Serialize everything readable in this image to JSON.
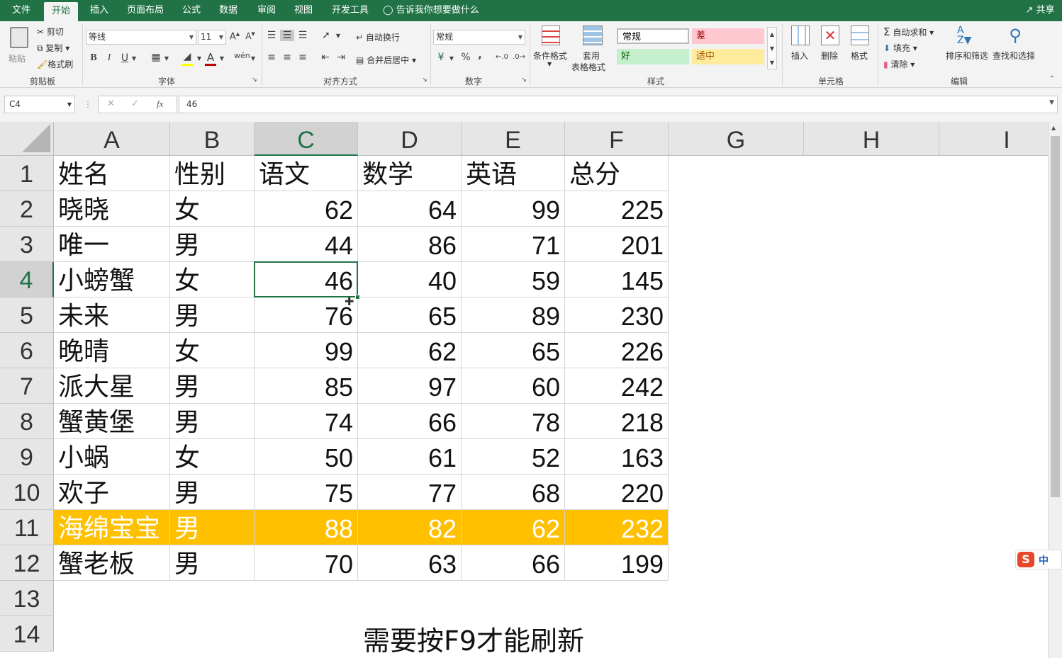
{
  "menu": {
    "tabs": [
      "文件",
      "开始",
      "插入",
      "页面布局",
      "公式",
      "数据",
      "审阅",
      "视图",
      "开发工具"
    ],
    "active": "开始",
    "tell_me": "告诉我你想要做什么",
    "share": "共享"
  },
  "ribbon": {
    "clipboard": {
      "paste": "粘贴",
      "cut": "剪切",
      "copy": "复制",
      "format_painter": "格式刷",
      "label": "剪贴板"
    },
    "font": {
      "name": "等线",
      "size": "11",
      "bold": "B",
      "italic": "I",
      "underline": "U",
      "label": "字体"
    },
    "alignment": {
      "wrap": "自动换行",
      "merge": "合并后居中",
      "label": "对齐方式"
    },
    "number": {
      "format": "常规",
      "percent": "%",
      "comma": ",",
      "label": "数字"
    },
    "styles": {
      "conditional": "条件格式",
      "table_line1": "套用",
      "table_line2": "表格格式",
      "normal": "常规",
      "bad": "差",
      "good": "好",
      "neutral": "适中",
      "label": "样式"
    },
    "cells": {
      "insert": "插入",
      "delete": "删除",
      "format": "格式",
      "label": "单元格"
    },
    "editing": {
      "autosum": "自动求和",
      "fill": "填充",
      "clear": "清除",
      "sort": "排序和筛选",
      "find": "查找和选择",
      "label": "编辑"
    }
  },
  "formula_bar": {
    "name_box": "C4",
    "fx": "fx",
    "value": "46"
  },
  "sheet": {
    "columns": [
      "A",
      "B",
      "C",
      "D",
      "E",
      "F",
      "G",
      "H",
      "I"
    ],
    "rows": [
      "1",
      "2",
      "3",
      "4",
      "5",
      "6",
      "7",
      "8",
      "9",
      "10",
      "11",
      "12",
      "13",
      "14"
    ],
    "header": [
      "姓名",
      "性别",
      "语文",
      "数学",
      "英语",
      "总分"
    ],
    "data": [
      [
        "晓晓",
        "女",
        "62",
        "64",
        "99",
        "225"
      ],
      [
        "唯一",
        "男",
        "44",
        "86",
        "71",
        "201"
      ],
      [
        "小螃蟹",
        "女",
        "46",
        "40",
        "59",
        "145"
      ],
      [
        "未来",
        "男",
        "76",
        "65",
        "89",
        "230"
      ],
      [
        "晚晴",
        "女",
        "99",
        "62",
        "65",
        "226"
      ],
      [
        "派大星",
        "男",
        "85",
        "97",
        "60",
        "242"
      ],
      [
        "蟹黄堡",
        "男",
        "74",
        "66",
        "78",
        "218"
      ],
      [
        "小蜗",
        "女",
        "50",
        "61",
        "52",
        "163"
      ],
      [
        "欢子",
        "男",
        "75",
        "77",
        "68",
        "220"
      ],
      [
        "海绵宝宝",
        "男",
        "88",
        "82",
        "62",
        "232"
      ],
      [
        "蟹老板",
        "男",
        "70",
        "63",
        "66",
        "199"
      ]
    ],
    "highlight_row": "11",
    "highlight_color": "#ffc000",
    "selected_cell": "C4",
    "note": "需要按F9才能刷新"
  },
  "ime": {
    "label": "中"
  },
  "colors": {
    "accent": "#217346"
  }
}
